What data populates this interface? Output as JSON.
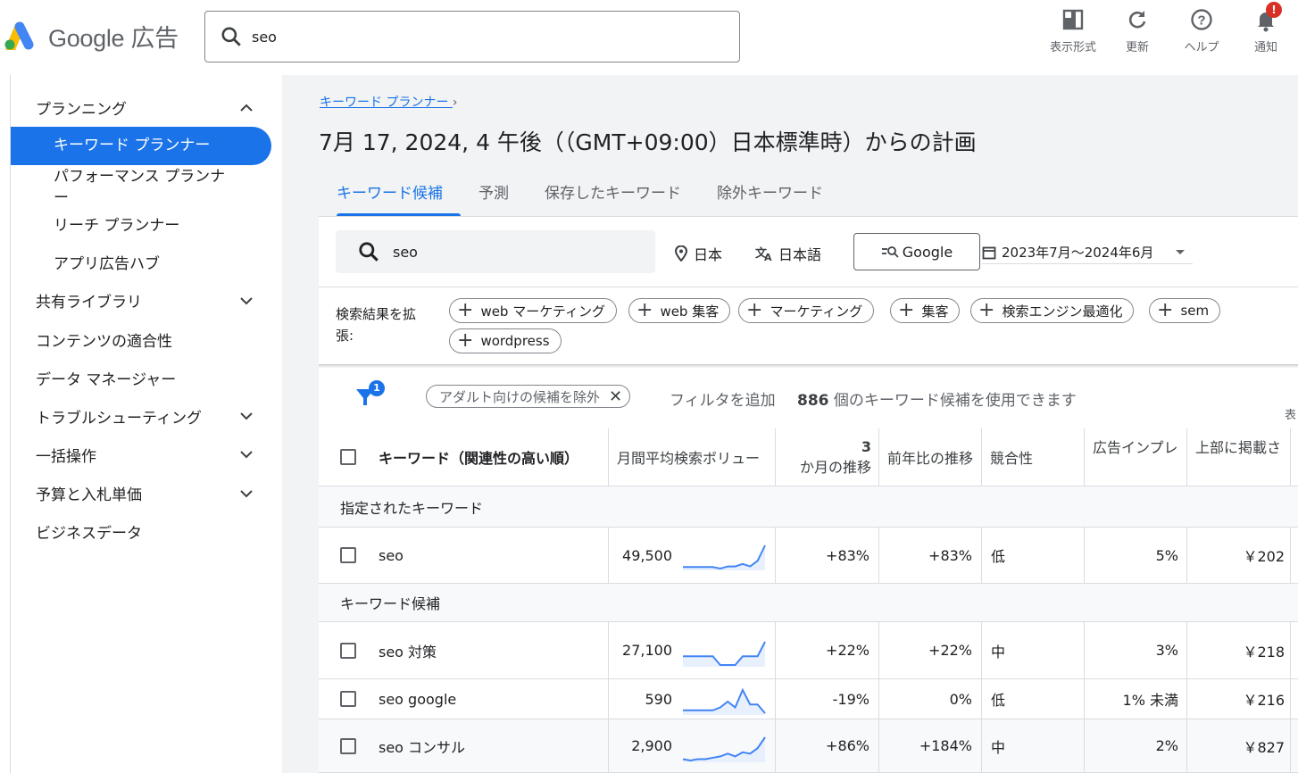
{
  "header": {
    "logo_text": "Google 広告",
    "search_query": "seo",
    "actions": [
      {
        "label": "表示形式",
        "icon": "display-format-icon"
      },
      {
        "label": "更新",
        "icon": "refresh-icon"
      },
      {
        "label": "ヘルプ",
        "icon": "help-icon"
      },
      {
        "label": "通知",
        "icon": "bell-icon"
      }
    ],
    "notification_badge": "!"
  },
  "sidebar": {
    "planning": "プランニング",
    "keyword_planner": "キーワード プランナー",
    "performance_planner_1": "パフォーマンス プランナ",
    "performance_planner_2": "ー",
    "reach_planner": "リーチ プランナー",
    "app_hub": "アプリ広告ハブ",
    "shared_library": "共有ライブラリ",
    "content_suitability": "コンテンツの適合性",
    "data_manager": "データ マネージャー",
    "troubleshooting": "トラブルシューティング",
    "bulk_actions": "一括操作",
    "budgets_bids": "予算と入札単価",
    "business_data": "ビジネスデータ"
  },
  "breadcrumb": "キーワード プランナー",
  "page_title": "7月 17, 2024, 4 午後（（GMT+09:00）日本標準時）からの計画",
  "tabs": [
    "キーワード候補",
    "予測",
    "保存したキーワード",
    "除外キーワード"
  ],
  "search_panel": {
    "query": "seo",
    "location": "日本",
    "language": "日本語",
    "network": "Google",
    "date_range": "2023年7月～2024年6月",
    "expand_label": "検索結果を拡張:",
    "chips": [
      "web マーケティング",
      "web 集客",
      "マーケティング",
      "集客",
      "検索エンジン最適化",
      "sem",
      "wordpress"
    ]
  },
  "filter_bar": {
    "filter_count": "1",
    "adult_chip": "アダルト向けの候補を除外",
    "add_filter": "フィルタを追加",
    "count_number": "886",
    "count_text": " 個のキーワード候補を使用できます",
    "cut_label": "表"
  },
  "table": {
    "headers": {
      "keyword": "キーワード（関連性の高い順）",
      "volume": "月間平均検索ボリュー",
      "three_month_1": "3",
      "three_month_2": "か月の推移",
      "yoy": "前年比の推移",
      "competition": "競合性",
      "impression_share": "広告インプレ",
      "top_bid": "上部に掲載さ"
    },
    "group_specified": "指定されたキーワード",
    "group_ideas": "キーワード候補",
    "rows": [
      {
        "keyword": "seo",
        "volume": "49,500",
        "three_month": "+83%",
        "yoy": "+83%",
        "competition": "低",
        "impression": "5%",
        "bid": "￥202",
        "trend": [
          3,
          3,
          3,
          3,
          3,
          2.5,
          3.2,
          3.2,
          4,
          3.2,
          5,
          10
        ]
      },
      {
        "keyword": "seo 対策",
        "volume": "27,100",
        "three_month": "+22%",
        "yoy": "+22%",
        "competition": "中",
        "impression": "3%",
        "bid": "￥218",
        "trend": [
          5,
          5,
          5,
          5,
          5,
          2,
          2,
          2,
          5,
          5,
          5,
          10
        ]
      },
      {
        "keyword": "seo google",
        "volume": "590",
        "three_month": "-19%",
        "yoy": "0%",
        "competition": "低",
        "impression": "1% 未満",
        "bid": "￥216",
        "trend": [
          2,
          2,
          2,
          2,
          2,
          3,
          5,
          3,
          9,
          4,
          4,
          1
        ]
      },
      {
        "keyword": "seo コンサル",
        "volume": "2,900",
        "three_month": "+86%",
        "yoy": "+184%",
        "competition": "中",
        "impression": "2%",
        "bid": "￥827",
        "trend": [
          2,
          1.5,
          2,
          2,
          2.5,
          3,
          4,
          3,
          4.5,
          4,
          6,
          10
        ]
      }
    ]
  },
  "colors": {
    "accent": "#1a73e8",
    "sparkline": "#4285f4",
    "badge": "#d93025"
  }
}
